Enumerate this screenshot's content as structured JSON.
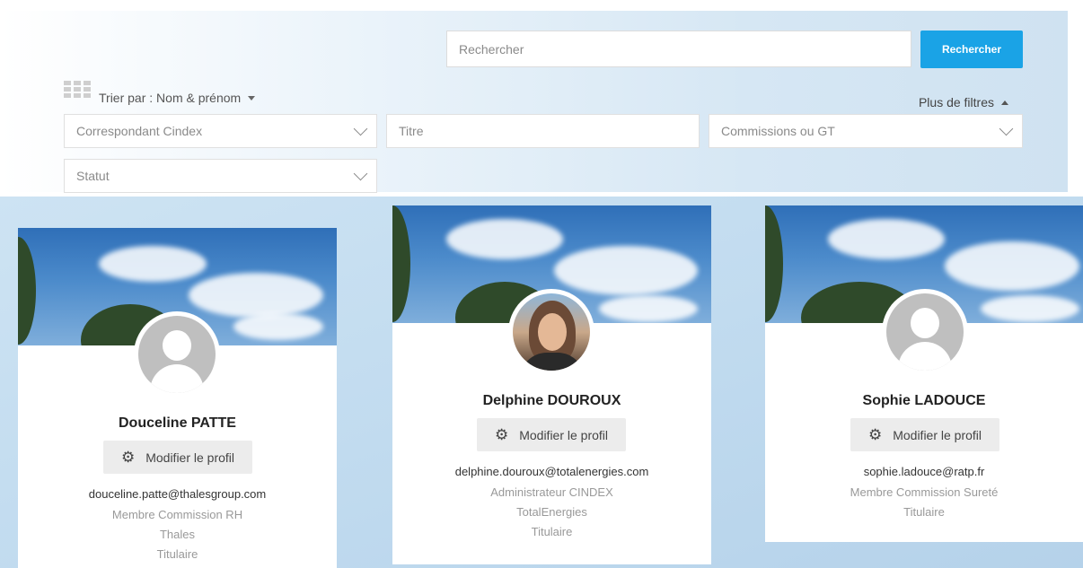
{
  "search": {
    "placeholder": "Rechercher",
    "button_label": "Rechercher"
  },
  "sort": {
    "label": "Trier par : Nom & prénom"
  },
  "more_filters": {
    "label": "Plus de filtres"
  },
  "filters": {
    "correspondant": "Correspondant Cindex",
    "titre": "Titre",
    "commissions": "Commissions ou GT",
    "statut": "Statut"
  },
  "icons": {
    "view_toggle": "grid-icon",
    "sort_caret": "caret-down-icon",
    "filters_caret": "caret-up-icon",
    "select_chevron": "chevron-down-icon",
    "edit": "gear-icon"
  },
  "colors": {
    "accent": "#1aa3e6",
    "panel": "#dbe9f5"
  },
  "members": [
    {
      "name": "Douceline PATTE",
      "edit_label": "Modifier le profil",
      "email": "douceline.patte@thalesgroup.com",
      "role": "Membre Commission RH",
      "company": "Thales",
      "status": "Titulaire"
    },
    {
      "name": "Delphine DOUROUX",
      "edit_label": "Modifier le profil",
      "email": "delphine.douroux@totalenergies.com",
      "role": "Administrateur CINDEX",
      "company": "TotalEnergies",
      "status": "Titulaire"
    },
    {
      "name": "Sophie LADOUCE",
      "edit_label": "Modifier le profil",
      "email": "sophie.ladouce@ratp.fr",
      "role": "Membre Commission Sureté",
      "status": "Titulaire"
    }
  ]
}
